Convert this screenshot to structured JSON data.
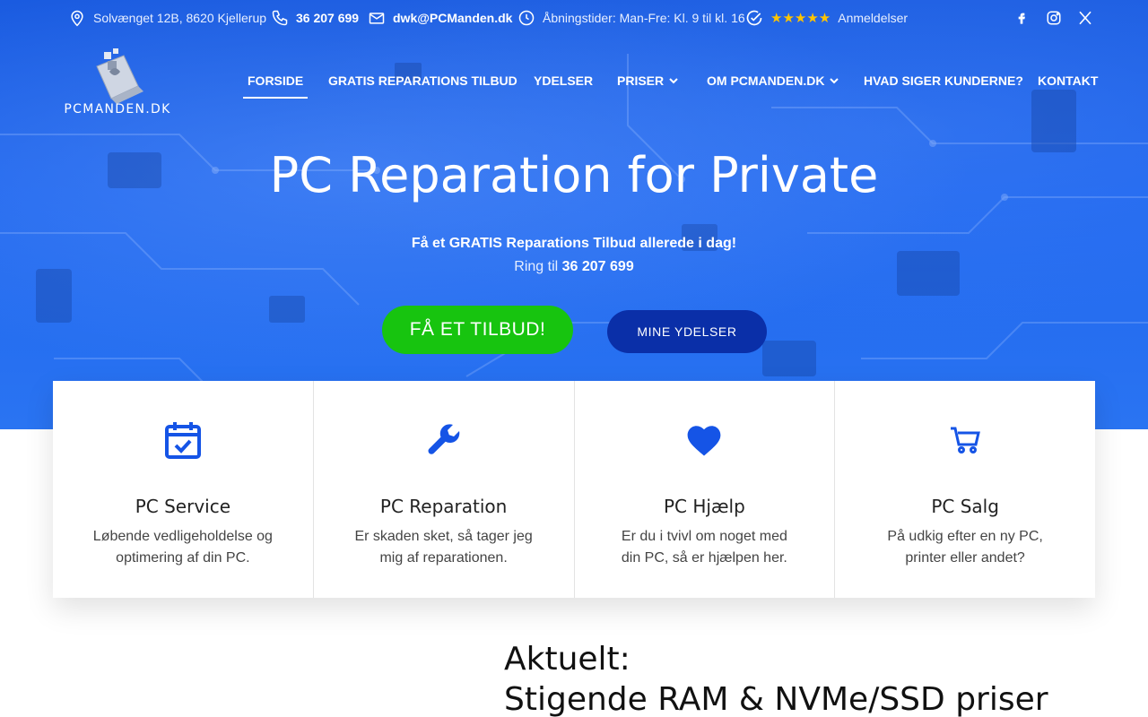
{
  "topbar": {
    "address": "Solvænget 12B, 8620 Kjellerup",
    "phone": "36 207 699",
    "email": "dwk@PCManden.dk",
    "hours": "Åbningstider: Man-Fre: Kl. 9 til kl. 16",
    "stars": "★★★★★",
    "reviews": "Anmeldelser",
    "social": [
      "facebook-icon",
      "instagram-icon",
      "x-icon"
    ]
  },
  "logo": {
    "text": "PCMANDEN.DK"
  },
  "nav": {
    "items": [
      {
        "label": "FORSIDE"
      },
      {
        "label": "GRATIS REPARATIONS TILBUD"
      },
      {
        "label": "YDELSER"
      },
      {
        "label": "PRISER"
      },
      {
        "label": "OM PCMANDEN.DK"
      },
      {
        "label": "HVAD SIGER KUNDERNE?"
      },
      {
        "label": "KONTAKT"
      }
    ],
    "dropdown_chevron": "⌄"
  },
  "hero": {
    "title": "PC Reparation for Private",
    "subtitle": "Få et GRATIS Reparations Tilbud allerede i dag!",
    "call_prefix": "Ring til",
    "call_number": "36 207 699",
    "cta_primary": "FÅ ET TILBUD!",
    "cta_secondary": "MINE YDELSER"
  },
  "cards": [
    {
      "title": "PC Service",
      "text": "Løbende vedligeholdelse og optimering af din PC.",
      "icon": "calendar-check-icon"
    },
    {
      "title": "PC Reparation",
      "text": "Er skaden sket, så tager jeg mig af reparationen.",
      "icon": "wrench-icon"
    },
    {
      "title": "PC Hjælp",
      "text": "Er du i tvivl om noget med din PC, så er hjælpen her.",
      "icon": "heart-icon"
    },
    {
      "title": "PC Salg",
      "text": "På udkig efter en ny PC, printer eller andet?",
      "icon": "cart-icon"
    }
  ],
  "news": {
    "heading": "Aktuelt:",
    "title": "Stigende RAM & NVMe/SSD priser"
  },
  "colors": {
    "accent_blue": "#1a5be0",
    "icon_blue": "#1554e6",
    "cta_green": "#17c40f",
    "cta_dark_blue": "#0a2fa8",
    "star": "#ffc400"
  }
}
